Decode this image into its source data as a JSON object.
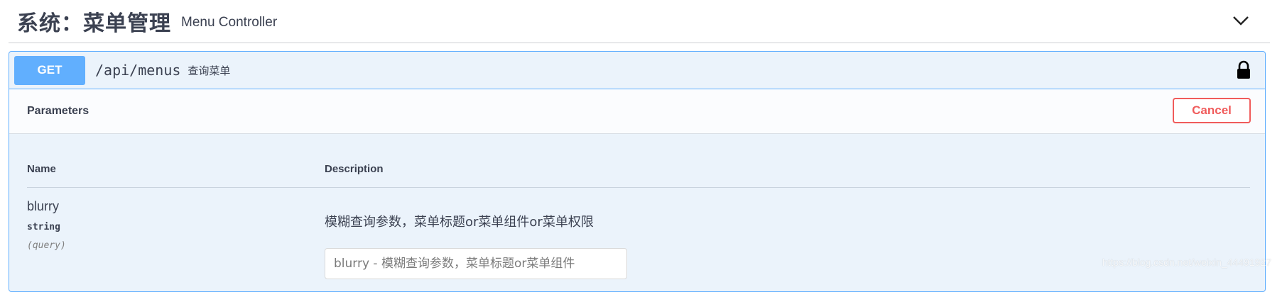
{
  "tag": {
    "title": "系统：菜单管理",
    "description": "Menu Controller",
    "toggle_icon": "chevron-down-icon"
  },
  "operation": {
    "method": "GET",
    "path": "/api/menus",
    "summary": "查询菜单",
    "lock_icon": "lock-icon",
    "colors": {
      "method_bg": "#61affe",
      "block_bg": "#ebf3fb",
      "border": "#61affe",
      "cancel": "#f05b5b"
    }
  },
  "parameters_section": {
    "title": "Parameters",
    "cancel_label": "Cancel",
    "columns": {
      "name": "Name",
      "description": "Description"
    },
    "params": [
      {
        "name": "blurry",
        "type": "string",
        "in": "(query)",
        "description": "模糊查询参数，菜单标题or菜单组件or菜单权限",
        "input_placeholder": "blurry - 模糊查询参数，菜单标题or菜单组件",
        "input_value": ""
      }
    ]
  },
  "watermark": "https://blog.csdn.net/weixin_44491927"
}
